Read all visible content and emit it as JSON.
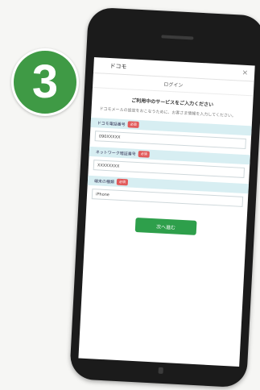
{
  "step_badge": {
    "number": "3"
  },
  "app": {
    "brand": "ドコモ",
    "subtitle": "ログイン",
    "panel_title": "ご利用中のサービスをご入力ください",
    "description": "ドコモメールの設定をおこなうために、お客さま情報を入力してください。",
    "fields": [
      {
        "label": "ドコモ電話番号",
        "required_label": "必須",
        "value": "090XXXXX"
      },
      {
        "label": "ネットワーク暗証番号",
        "required_label": "必須",
        "value": "XXXXXXXX"
      },
      {
        "label": "端末の種類",
        "required_label": "必須",
        "value": "iPhone"
      }
    ],
    "submit_label": "次へ進む"
  },
  "colors": {
    "badge": "#3f9a45",
    "field_label_bg": "#d7eef2",
    "required": "#e25b5b",
    "submit": "#2e9f4b"
  }
}
